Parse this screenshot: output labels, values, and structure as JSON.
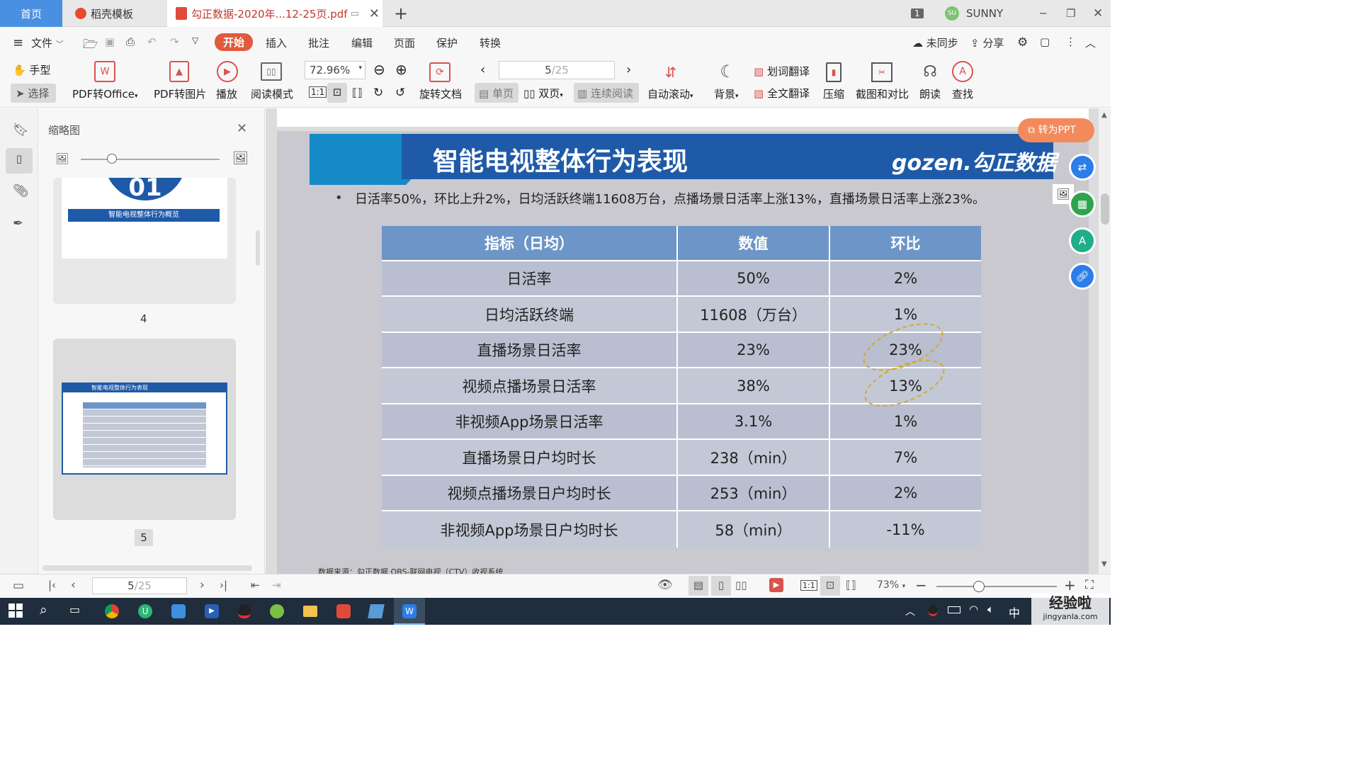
{
  "tabs": {
    "home": "首页",
    "template": "稻壳模板",
    "doc": "勾正数据-2020年...12-25页.pdf",
    "add": "+",
    "badge": "1",
    "user_initials": "SU",
    "user": "SUNNY"
  },
  "menu": {
    "file": "文件",
    "start": "开始",
    "insert": "插入",
    "annotate": "批注",
    "edit": "编辑",
    "page": "页面",
    "protect": "保护",
    "convert": "转换",
    "sync": "未同步",
    "share": "分享"
  },
  "ribbon": {
    "hand": "手型",
    "select": "选择",
    "pdf2office": "PDF转Office",
    "pdf2img": "PDF转图片",
    "play": "播放",
    "readmode": "阅读模式",
    "zoom": "72.96%",
    "rotate": "旋转文档",
    "page_current": "5",
    "page_total": "/25",
    "single": "单页",
    "double": "双页",
    "continuous": "连续阅读",
    "autoscroll": "自动滚动",
    "background": "背景",
    "word_translate": "划词翻译",
    "full_translate": "全文翻译",
    "compress": "压缩",
    "screenshot": "截图和对比",
    "read_aloud": "朗读",
    "find": "查找"
  },
  "thumbs": {
    "title": "缩略图",
    "page4_label": "4",
    "page5_label": "5",
    "page4_caption": "智能电视整体行为概览",
    "page4_num": "01",
    "page5_title": "智能电视整体行为表现"
  },
  "slide": {
    "title": "智能电视整体行为表现",
    "logo": "gozen.勾正数据",
    "bullet": "日活率50%，环比上升2%，日均活跃终端11608万台，点播场景日活率上涨13%，直播场景日活率上涨23%。",
    "source": "数据来源：勾正数据 OBS-联网电视（CTV）收视系统",
    "headers": [
      "指标（日均）",
      "数值",
      "环比"
    ],
    "rows": [
      [
        "日活率",
        "50%",
        "2%"
      ],
      [
        "日均活跃终端",
        "11608（万台）",
        "1%"
      ],
      [
        "直播场景日活率",
        "23%",
        "23%"
      ],
      [
        "视频点播场景日活率",
        "38%",
        "13%"
      ],
      [
        "非视频App场景日活率",
        "3.1%",
        "1%"
      ],
      [
        "直播场景日户均时长",
        "238（min）",
        "7%"
      ],
      [
        "视频点播场景日户均时长",
        "253（min）",
        "2%"
      ],
      [
        "非视频App场景日户均时长",
        "58（min）",
        "-11%"
      ]
    ]
  },
  "float": {
    "to_ppt": "转为PPT"
  },
  "status": {
    "page_current": "5",
    "page_total": "/25",
    "zoom": "73%"
  },
  "taskbar": {
    "ime": "中",
    "watermark": "经验啦",
    "watermark_url": "jingyanla.com"
  },
  "colors": {
    "accent": "#e05a3c",
    "header_blue": "#1e5aa8",
    "table_header": "#6d95c8",
    "table_row": "#b9bfd0",
    "table_row_alt": "#c3c8d6"
  }
}
